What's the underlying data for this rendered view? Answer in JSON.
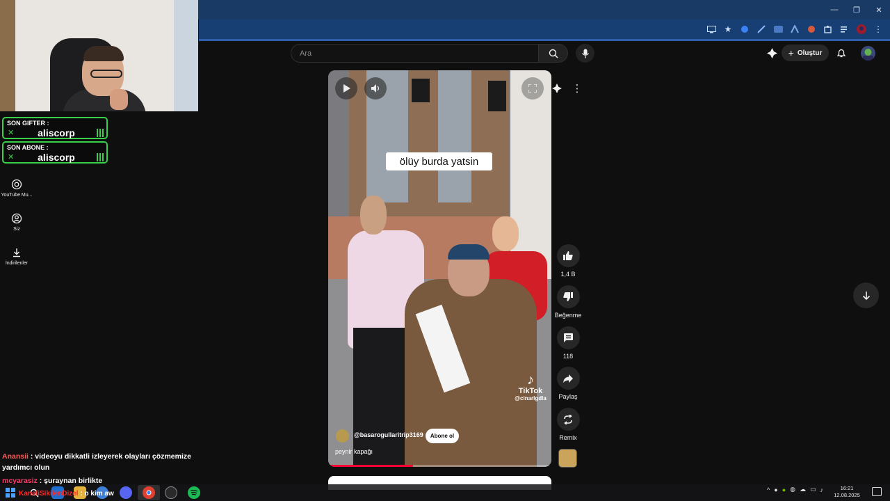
{
  "browser": {
    "window_controls": {
      "minimize": "—",
      "restore": "❐",
      "close": "✕"
    }
  },
  "overlay": {
    "alerts": [
      {
        "label": "SON GIFTER :",
        "name": "aliscorp"
      },
      {
        "label": "SON ABONE :",
        "name": "aliscorp"
      }
    ]
  },
  "sidebar": {
    "items": [
      {
        "label": "YouTube Mu...",
        "icon": "youtube-music-icon"
      },
      {
        "label": "Siz",
        "icon": "account-icon"
      },
      {
        "label": "İndirilenler",
        "icon": "download-icon"
      }
    ]
  },
  "masthead": {
    "search_placeholder": "Ara",
    "create_label": "Oluştur"
  },
  "short": {
    "caption": "ölüy burda yatsin",
    "channel_handle": "@basarogullaritrip3169",
    "subscribe_label": "Abone ol",
    "title": "peynir kapağı",
    "watermark_brand": "TikTok",
    "watermark_handle": "@cinarlgdla",
    "progress": 0.38
  },
  "actions": {
    "like_count": "1,4 B",
    "dislike_label": "Beğenme",
    "comment_count": "118",
    "share_label": "Paylaş",
    "remix_label": "Remix"
  },
  "chat": [
    {
      "user": "Anansii",
      "user_color": "#ff5a5a",
      "message": " : videoyu dikkatli izleyerek olayları çözmemize yardımcı olun"
    },
    {
      "user": "mcyarasiz",
      "user_color": "#ff3b6b",
      "message": " : şuraynan birlikte"
    },
    {
      "user": "KanaliSikilenDizel",
      "user_color": "#ff2a2a",
      "message": " : o kim aw"
    }
  ],
  "taskbar": {
    "time": "16:21",
    "date": "12.08.2025"
  },
  "colors": {
    "accent": "#ff0033",
    "alert_green": "#39d04a",
    "browser_frame": "#173f74"
  }
}
